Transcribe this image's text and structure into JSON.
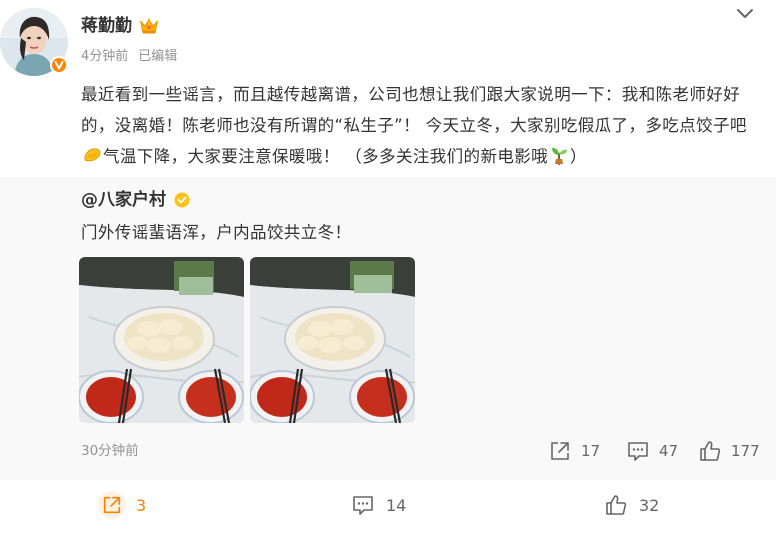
{
  "post": {
    "author": {
      "name": "蒋勤勤",
      "badge_icon": "crown-icon"
    },
    "meta": {
      "time": "4分钟前",
      "edited": "已编辑"
    },
    "text": {
      "part1": "最近看到一些谣言，而且越传越离谱，公司也想让我们跟大家说明一下：我和陈老师好好的，没离婚！陈老师也没有所谓的“私生子”！ 今天立冬，大家别吃假瓜了，多吃点饺子吧",
      "emoji1": "dumpling-emoji",
      "part2": "气温下降，大家要注意保暖哦！ （多多关注我们的新电影哦",
      "emoji2": "sprout-emoji",
      "part3": "）"
    },
    "accent_color": "#ff8200"
  },
  "repost": {
    "author": "@八家户村",
    "text": "门外传谣蜚语浑，户内品饺共立冬！",
    "images": [
      "dumplings-photo-1",
      "dumplings-photo-2"
    ],
    "time": "30分钟前",
    "shares": "17",
    "comments": "47",
    "likes": "177"
  },
  "footer": {
    "shares": "3",
    "comments": "14",
    "likes": "32"
  }
}
